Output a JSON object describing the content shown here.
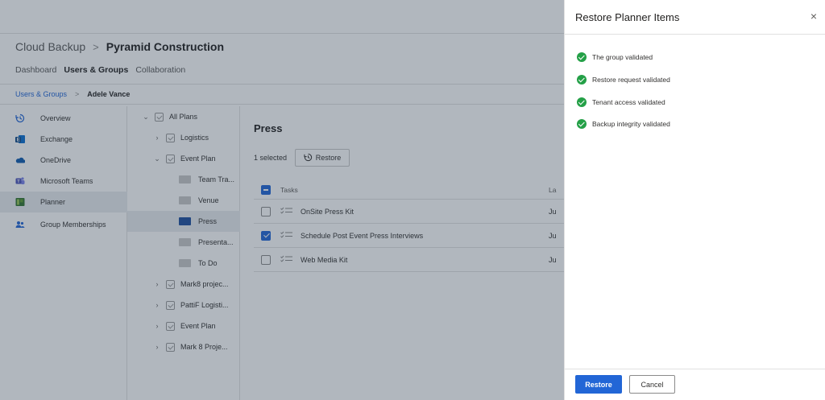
{
  "header": {
    "app_crumb": "Cloud Backup",
    "separator": ">",
    "org_crumb": "Pyramid Construction"
  },
  "nav_tabs": [
    {
      "label": "Dashboard",
      "active": false
    },
    {
      "label": "Users & Groups",
      "active": true
    },
    {
      "label": "Collaboration",
      "active": false
    }
  ],
  "breadcrumb": {
    "parent": "Users & Groups",
    "separator": ">",
    "current": "Adele Vance"
  },
  "sidebar": {
    "items": [
      {
        "label": "Overview",
        "icon": "history-icon",
        "active": false
      },
      {
        "label": "Exchange",
        "icon": "exchange-icon",
        "active": false
      },
      {
        "label": "OneDrive",
        "icon": "onedrive-icon",
        "active": false
      },
      {
        "label": "Microsoft Teams",
        "icon": "teams-icon",
        "active": false
      },
      {
        "label": "Planner",
        "icon": "planner-icon",
        "active": true
      },
      {
        "label": "Group Memberships",
        "icon": "people-icon",
        "active": false
      }
    ]
  },
  "tree": {
    "items": [
      {
        "label": "All Plans",
        "chevron": "down",
        "icon": "plan-icon"
      },
      {
        "label": "Logistics",
        "chevron": "right",
        "icon": "plan-icon"
      },
      {
        "label": "Event Plan",
        "chevron": "down",
        "icon": "plan-icon"
      },
      {
        "label": "Team Tra...",
        "chevron": "",
        "icon": "folder-icon"
      },
      {
        "label": "Venue",
        "chevron": "",
        "icon": "folder-icon"
      },
      {
        "label": "Press",
        "chevron": "",
        "icon": "folder-icon",
        "active": true
      },
      {
        "label": "Presenta...",
        "chevron": "",
        "icon": "folder-icon"
      },
      {
        "label": "To Do",
        "chevron": "",
        "icon": "folder-icon"
      },
      {
        "label": "Mark8 projec...",
        "chevron": "right",
        "icon": "plan-icon"
      },
      {
        "label": "PattiF Logisti...",
        "chevron": "right",
        "icon": "plan-icon"
      },
      {
        "label": "Event Plan",
        "chevron": "right",
        "icon": "plan-icon"
      },
      {
        "label": "Mark 8 Proje...",
        "chevron": "right",
        "icon": "plan-icon"
      }
    ]
  },
  "main": {
    "title": "Press",
    "selection_text": "1 selected",
    "restore_label": "Restore",
    "table": {
      "header": {
        "col_tasks": "Tasks",
        "col_extra": "La"
      },
      "rows": [
        {
          "task": "OnSite Press Kit",
          "extra": "Ju",
          "checked": false
        },
        {
          "task": "Schedule Post Event Press Interviews",
          "extra": "Ju",
          "checked": true
        },
        {
          "task": "Web Media Kit",
          "extra": "Ju",
          "checked": false
        }
      ]
    }
  },
  "panel": {
    "title": "Restore Planner Items",
    "close_glyph": "×",
    "validations": [
      "The group validated",
      "Restore request validated",
      "Tenant access validated",
      "Backup integrity validated"
    ],
    "restore_button": "Restore",
    "cancel_button": "Cancel"
  },
  "colors": {
    "accent": "#2266d6",
    "success": "#24a047",
    "scrim": "rgba(40,55,75,0.36)"
  }
}
